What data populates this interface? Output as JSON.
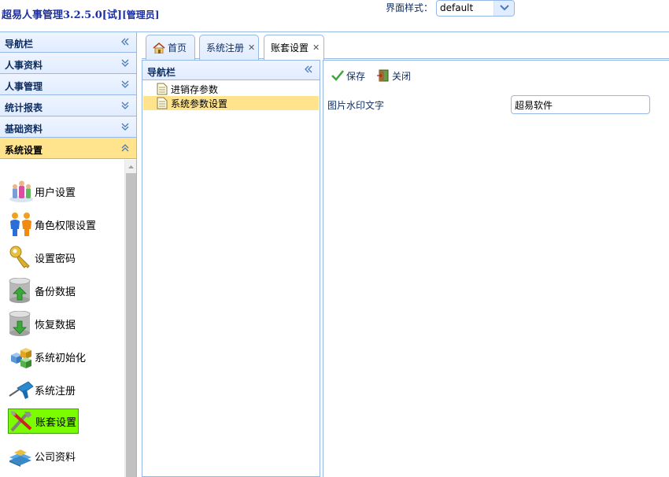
{
  "header": {
    "app_title": "超易人事管理3.2.5.0[试]",
    "role": "[管理员]",
    "theme_label": "界面样式：",
    "theme_value": "default"
  },
  "left_nav": {
    "title": "导航栏",
    "sections": [
      {
        "label": "人事资料"
      },
      {
        "label": "人事管理"
      },
      {
        "label": "统计报表"
      },
      {
        "label": "基础资料"
      },
      {
        "label": "系统设置"
      }
    ],
    "active_section": "系统设置",
    "items": [
      {
        "label": "用户设置",
        "icon": "users-icon"
      },
      {
        "label": "角色权限设置",
        "icon": "role-people-icon"
      },
      {
        "label": "设置密码",
        "icon": "key-icon"
      },
      {
        "label": "备份数据",
        "icon": "database-backup-icon"
      },
      {
        "label": "恢复数据",
        "icon": "database-restore-icon"
      },
      {
        "label": "系统初始化",
        "icon": "cubes-icon"
      },
      {
        "label": "系统注册",
        "icon": "drill-icon"
      },
      {
        "label": "账套设置",
        "icon": "tools-icon"
      },
      {
        "label": "公司资料",
        "icon": "company-books-icon"
      }
    ],
    "selected_item": "账套设置"
  },
  "tabs": [
    {
      "label": "首页",
      "icon": "home-icon",
      "closable": false
    },
    {
      "label": "系统注册",
      "closable": true
    },
    {
      "label": "账套设置",
      "closable": true,
      "active": true
    }
  ],
  "inner_nav": {
    "title": "导航栏",
    "nodes": [
      {
        "label": "进销存参数"
      },
      {
        "label": "系统参数设置",
        "selected": true
      }
    ]
  },
  "content": {
    "save_label": "保存",
    "close_label": "关闭",
    "field_label": "图片水印文字",
    "field_value": "超易软件"
  },
  "colors": {
    "border": "#95b8e7",
    "header_grad": "#e0ecff",
    "selected": "#ffe48d",
    "selected_item": "#7cfc00",
    "title": "#1a2fa8"
  }
}
